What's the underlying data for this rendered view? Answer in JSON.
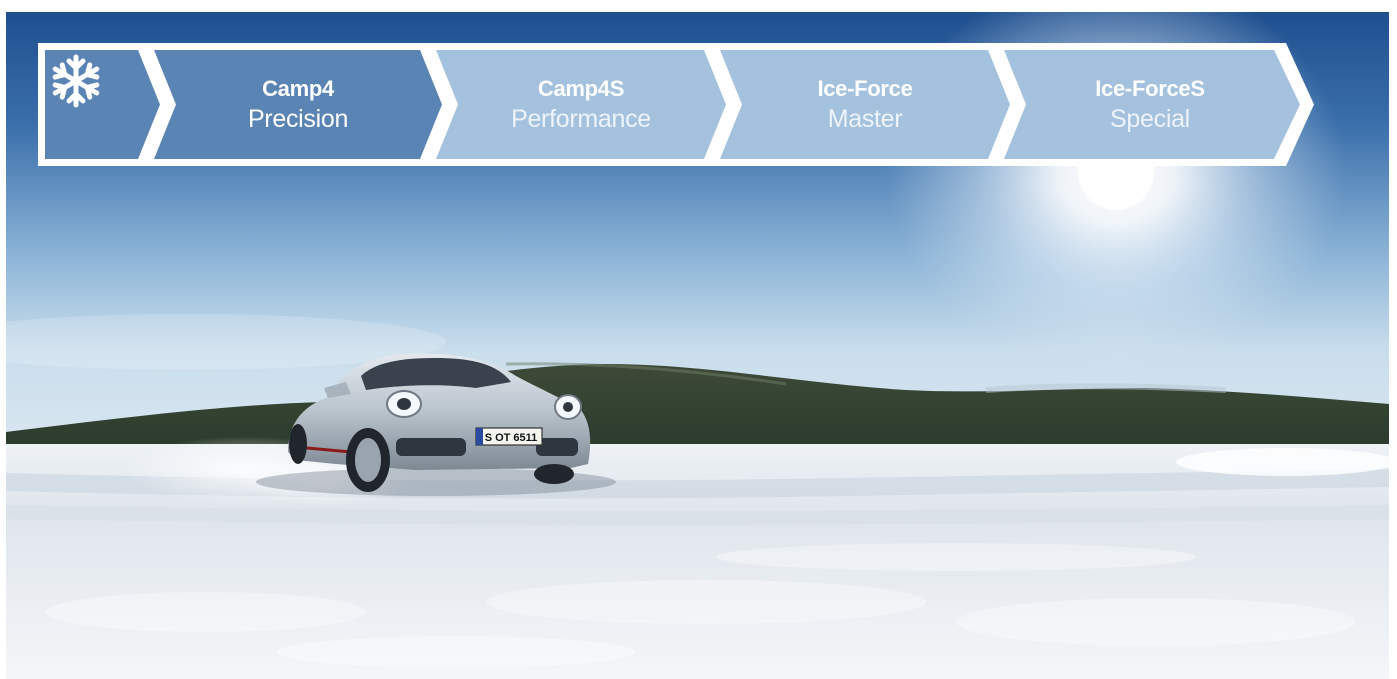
{
  "steps": [
    {
      "name": "Camp4",
      "sub": "Precision",
      "active": true
    },
    {
      "name": "Camp4S",
      "sub": "Performance",
      "active": false
    },
    {
      "name": "Ice-Force",
      "sub": "Master",
      "active": false
    },
    {
      "name": "Ice-ForceS",
      "sub": "Special",
      "active": false
    }
  ],
  "plate": "S OT 6511",
  "icons": {
    "home": "snowflake-icon"
  },
  "colors": {
    "active_step": "#5a84b4",
    "inactive_step": "#a4c2de",
    "border": "#ffffff"
  }
}
